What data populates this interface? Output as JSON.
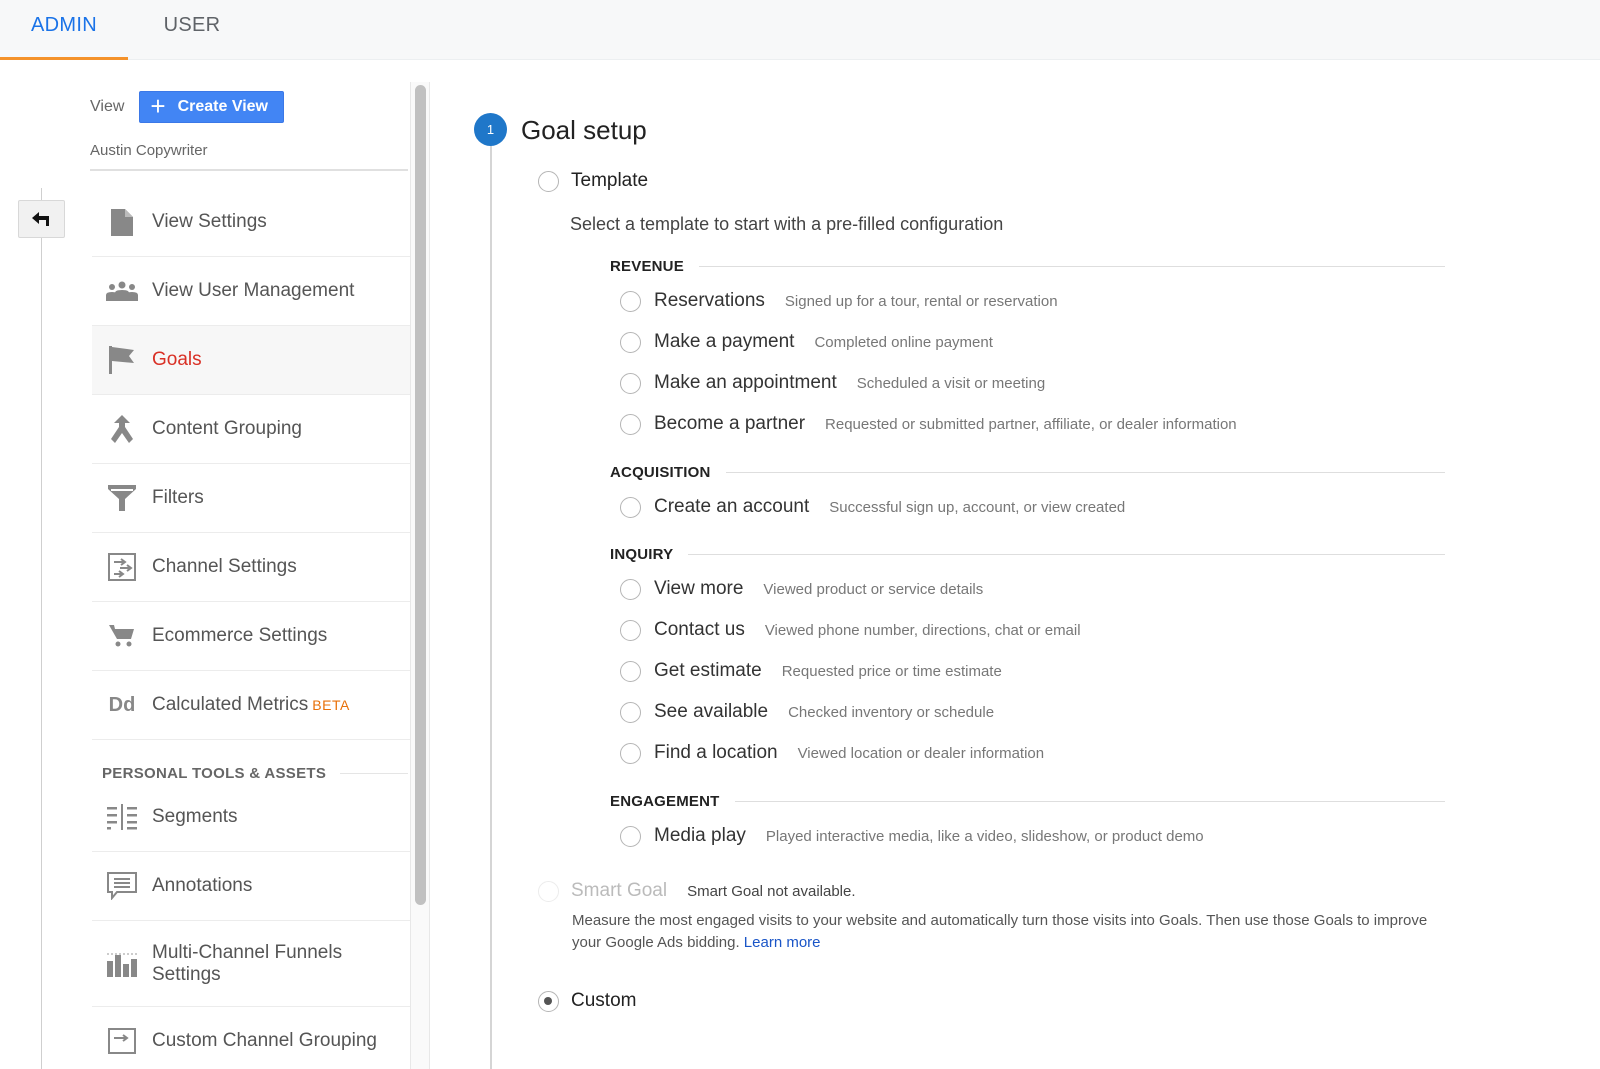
{
  "tabs": [
    {
      "label": "ADMIN",
      "active": true
    },
    {
      "label": "USER",
      "active": false
    }
  ],
  "colors": {
    "accent_blue": "#1a73e8",
    "tab_underline": "#f4922b",
    "button_blue": "#4285f4",
    "active_nav_red": "#d93025",
    "beta_orange": "#e8710a",
    "step_blue": "#1f77c9",
    "link_blue": "#1a55c7"
  },
  "sidebar": {
    "view_label": "View",
    "create_view_label": "Create View",
    "account_name": "Austin Copywriter",
    "back_icon": "back-arrow-icon",
    "items": [
      {
        "label": "View Settings",
        "icon": "document-icon"
      },
      {
        "label": "View User Management",
        "icon": "people-icon"
      },
      {
        "label": "Goals",
        "icon": "flag-icon",
        "active": true
      },
      {
        "label": "Content Grouping",
        "icon": "merge-arrows-icon"
      },
      {
        "label": "Filters",
        "icon": "funnel-icon"
      },
      {
        "label": "Channel Settings",
        "icon": "channel-arrows-icon"
      },
      {
        "label": "Ecommerce Settings",
        "icon": "cart-icon"
      },
      {
        "label": "Calculated Metrics",
        "badge": "BETA",
        "icon": "dd-icon",
        "icon_text": "Dd"
      }
    ],
    "section_title": "PERSONAL TOOLS & ASSETS",
    "personal_items": [
      {
        "label": "Segments",
        "icon": "segments-icon"
      },
      {
        "label": "Annotations",
        "icon": "comment-icon"
      },
      {
        "label": "Multi-Channel Funnels Settings",
        "icon": "bar-chart-icon"
      },
      {
        "label": "Custom Channel Grouping",
        "icon": "channel-grouping-icon"
      }
    ]
  },
  "main": {
    "step_number": "1",
    "step_title": "Goal setup",
    "template_option": {
      "label": "Template",
      "selected": false
    },
    "template_description": "Select a template to start with a pre-filled configuration",
    "categories": [
      {
        "name": "REVENUE",
        "templates": [
          {
            "label": "Reservations",
            "desc": "Signed up for a tour, rental or reservation"
          },
          {
            "label": "Make a payment",
            "desc": "Completed online payment"
          },
          {
            "label": "Make an appointment",
            "desc": "Scheduled a visit or meeting"
          },
          {
            "label": "Become a partner",
            "desc": "Requested or submitted partner, affiliate, or dealer information"
          }
        ]
      },
      {
        "name": "ACQUISITION",
        "templates": [
          {
            "label": "Create an account",
            "desc": "Successful sign up, account, or view created"
          }
        ]
      },
      {
        "name": "INQUIRY",
        "templates": [
          {
            "label": "View more",
            "desc": "Viewed product or service details"
          },
          {
            "label": "Contact us",
            "desc": "Viewed phone number, directions, chat or email"
          },
          {
            "label": "Get estimate",
            "desc": "Requested price or time estimate"
          },
          {
            "label": "See available",
            "desc": "Checked inventory or schedule"
          },
          {
            "label": "Find a location",
            "desc": "Viewed location or dealer information"
          }
        ]
      },
      {
        "name": "ENGAGEMENT",
        "templates": [
          {
            "label": "Media play",
            "desc": "Played interactive media, like a video, slideshow, or product demo"
          }
        ]
      }
    ],
    "smart_goal": {
      "label": "Smart Goal",
      "status": "Smart Goal not available.",
      "description": "Measure the most engaged visits to your website and automatically turn those visits into Goals. Then use those Goals to improve your Google Ads bidding.",
      "link": "Learn more",
      "disabled": true
    },
    "custom_option": {
      "label": "Custom",
      "selected": true
    }
  }
}
